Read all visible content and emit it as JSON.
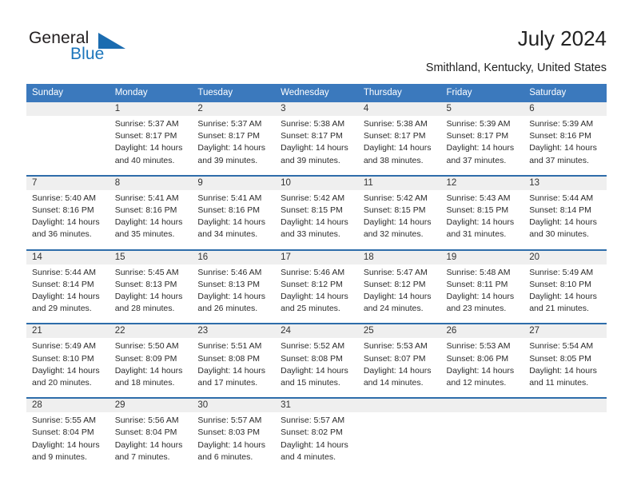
{
  "brand": {
    "name_part1": "General",
    "name_part2": "Blue",
    "triangle_color": "#1b6cb0",
    "blue_color": "#1b75bb"
  },
  "header": {
    "title": "July 2024",
    "location": "Smithland, Kentucky, United States",
    "header_bg": "#3b79bd",
    "row_divider_color": "#2e6daa",
    "daynum_bg": "#efefef"
  },
  "weekdays": [
    "Sunday",
    "Monday",
    "Tuesday",
    "Wednesday",
    "Thursday",
    "Friday",
    "Saturday"
  ],
  "weeks": [
    [
      {
        "day": "",
        "l1": "",
        "l2": "",
        "l3": "",
        "l4": ""
      },
      {
        "day": "1",
        "l1": "Sunrise: 5:37 AM",
        "l2": "Sunset: 8:17 PM",
        "l3": "Daylight: 14 hours",
        "l4": "and 40 minutes."
      },
      {
        "day": "2",
        "l1": "Sunrise: 5:37 AM",
        "l2": "Sunset: 8:17 PM",
        "l3": "Daylight: 14 hours",
        "l4": "and 39 minutes."
      },
      {
        "day": "3",
        "l1": "Sunrise: 5:38 AM",
        "l2": "Sunset: 8:17 PM",
        "l3": "Daylight: 14 hours",
        "l4": "and 39 minutes."
      },
      {
        "day": "4",
        "l1": "Sunrise: 5:38 AM",
        "l2": "Sunset: 8:17 PM",
        "l3": "Daylight: 14 hours",
        "l4": "and 38 minutes."
      },
      {
        "day": "5",
        "l1": "Sunrise: 5:39 AM",
        "l2": "Sunset: 8:17 PM",
        "l3": "Daylight: 14 hours",
        "l4": "and 37 minutes."
      },
      {
        "day": "6",
        "l1": "Sunrise: 5:39 AM",
        "l2": "Sunset: 8:16 PM",
        "l3": "Daylight: 14 hours",
        "l4": "and 37 minutes."
      }
    ],
    [
      {
        "day": "7",
        "l1": "Sunrise: 5:40 AM",
        "l2": "Sunset: 8:16 PM",
        "l3": "Daylight: 14 hours",
        "l4": "and 36 minutes."
      },
      {
        "day": "8",
        "l1": "Sunrise: 5:41 AM",
        "l2": "Sunset: 8:16 PM",
        "l3": "Daylight: 14 hours",
        "l4": "and 35 minutes."
      },
      {
        "day": "9",
        "l1": "Sunrise: 5:41 AM",
        "l2": "Sunset: 8:16 PM",
        "l3": "Daylight: 14 hours",
        "l4": "and 34 minutes."
      },
      {
        "day": "10",
        "l1": "Sunrise: 5:42 AM",
        "l2": "Sunset: 8:15 PM",
        "l3": "Daylight: 14 hours",
        "l4": "and 33 minutes."
      },
      {
        "day": "11",
        "l1": "Sunrise: 5:42 AM",
        "l2": "Sunset: 8:15 PM",
        "l3": "Daylight: 14 hours",
        "l4": "and 32 minutes."
      },
      {
        "day": "12",
        "l1": "Sunrise: 5:43 AM",
        "l2": "Sunset: 8:15 PM",
        "l3": "Daylight: 14 hours",
        "l4": "and 31 minutes."
      },
      {
        "day": "13",
        "l1": "Sunrise: 5:44 AM",
        "l2": "Sunset: 8:14 PM",
        "l3": "Daylight: 14 hours",
        "l4": "and 30 minutes."
      }
    ],
    [
      {
        "day": "14",
        "l1": "Sunrise: 5:44 AM",
        "l2": "Sunset: 8:14 PM",
        "l3": "Daylight: 14 hours",
        "l4": "and 29 minutes."
      },
      {
        "day": "15",
        "l1": "Sunrise: 5:45 AM",
        "l2": "Sunset: 8:13 PM",
        "l3": "Daylight: 14 hours",
        "l4": "and 28 minutes."
      },
      {
        "day": "16",
        "l1": "Sunrise: 5:46 AM",
        "l2": "Sunset: 8:13 PM",
        "l3": "Daylight: 14 hours",
        "l4": "and 26 minutes."
      },
      {
        "day": "17",
        "l1": "Sunrise: 5:46 AM",
        "l2": "Sunset: 8:12 PM",
        "l3": "Daylight: 14 hours",
        "l4": "and 25 minutes."
      },
      {
        "day": "18",
        "l1": "Sunrise: 5:47 AM",
        "l2": "Sunset: 8:12 PM",
        "l3": "Daylight: 14 hours",
        "l4": "and 24 minutes."
      },
      {
        "day": "19",
        "l1": "Sunrise: 5:48 AM",
        "l2": "Sunset: 8:11 PM",
        "l3": "Daylight: 14 hours",
        "l4": "and 23 minutes."
      },
      {
        "day": "20",
        "l1": "Sunrise: 5:49 AM",
        "l2": "Sunset: 8:10 PM",
        "l3": "Daylight: 14 hours",
        "l4": "and 21 minutes."
      }
    ],
    [
      {
        "day": "21",
        "l1": "Sunrise: 5:49 AM",
        "l2": "Sunset: 8:10 PM",
        "l3": "Daylight: 14 hours",
        "l4": "and 20 minutes."
      },
      {
        "day": "22",
        "l1": "Sunrise: 5:50 AM",
        "l2": "Sunset: 8:09 PM",
        "l3": "Daylight: 14 hours",
        "l4": "and 18 minutes."
      },
      {
        "day": "23",
        "l1": "Sunrise: 5:51 AM",
        "l2": "Sunset: 8:08 PM",
        "l3": "Daylight: 14 hours",
        "l4": "and 17 minutes."
      },
      {
        "day": "24",
        "l1": "Sunrise: 5:52 AM",
        "l2": "Sunset: 8:08 PM",
        "l3": "Daylight: 14 hours",
        "l4": "and 15 minutes."
      },
      {
        "day": "25",
        "l1": "Sunrise: 5:53 AM",
        "l2": "Sunset: 8:07 PM",
        "l3": "Daylight: 14 hours",
        "l4": "and 14 minutes."
      },
      {
        "day": "26",
        "l1": "Sunrise: 5:53 AM",
        "l2": "Sunset: 8:06 PM",
        "l3": "Daylight: 14 hours",
        "l4": "and 12 minutes."
      },
      {
        "day": "27",
        "l1": "Sunrise: 5:54 AM",
        "l2": "Sunset: 8:05 PM",
        "l3": "Daylight: 14 hours",
        "l4": "and 11 minutes."
      }
    ],
    [
      {
        "day": "28",
        "l1": "Sunrise: 5:55 AM",
        "l2": "Sunset: 8:04 PM",
        "l3": "Daylight: 14 hours",
        "l4": "and 9 minutes."
      },
      {
        "day": "29",
        "l1": "Sunrise: 5:56 AM",
        "l2": "Sunset: 8:04 PM",
        "l3": "Daylight: 14 hours",
        "l4": "and 7 minutes."
      },
      {
        "day": "30",
        "l1": "Sunrise: 5:57 AM",
        "l2": "Sunset: 8:03 PM",
        "l3": "Daylight: 14 hours",
        "l4": "and 6 minutes."
      },
      {
        "day": "31",
        "l1": "Sunrise: 5:57 AM",
        "l2": "Sunset: 8:02 PM",
        "l3": "Daylight: 14 hours",
        "l4": "and 4 minutes."
      },
      {
        "day": "",
        "l1": "",
        "l2": "",
        "l3": "",
        "l4": ""
      },
      {
        "day": "",
        "l1": "",
        "l2": "",
        "l3": "",
        "l4": ""
      },
      {
        "day": "",
        "l1": "",
        "l2": "",
        "l3": "",
        "l4": ""
      }
    ]
  ]
}
